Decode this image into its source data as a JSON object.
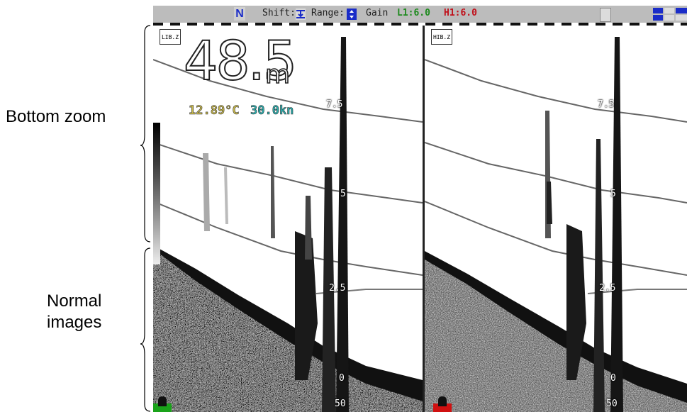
{
  "annotations": {
    "bottom_zoom": "Bottom zoom",
    "normal_images": [
      "Normal",
      "images"
    ]
  },
  "topbar": {
    "mode": "N",
    "shift_label": "Shift:",
    "range_label": "Range:",
    "gain_label": "Gain",
    "gain_low": "L1:6.0",
    "gain_high": "H1:6.0",
    "icons": [
      "shift-icon",
      "range-icon",
      "cm-icon",
      "frequency-icons"
    ],
    "colors": {
      "gain_low": "#1d8a1d",
      "gain_high": "#c0101a",
      "mode": "#1a2cc8"
    }
  },
  "left_pane": {
    "tag": "LIB.Z",
    "depth_value": "48.5",
    "depth_unit": "m",
    "water_temp": "12.89°C",
    "speed": "30.0kn",
    "scale_labels": [
      "7.5",
      "5",
      "2.5",
      "0",
      "50"
    ],
    "marker_color": "#1aa31a"
  },
  "right_pane": {
    "tag": "HIB.Z",
    "scale_labels": [
      "7.5",
      "5",
      "2.5",
      "0",
      "50"
    ],
    "marker_color": "#d01010"
  }
}
